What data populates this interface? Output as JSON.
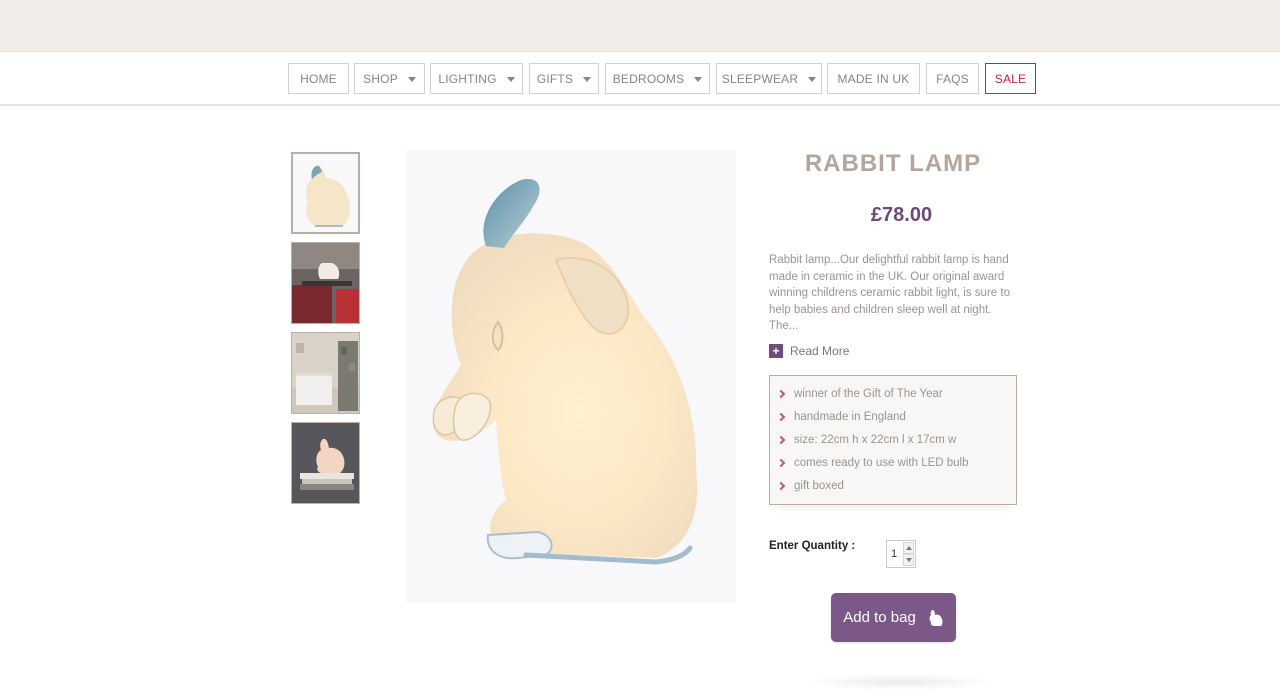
{
  "nav": {
    "items": [
      {
        "label": "HOME",
        "dropdown": false
      },
      {
        "label": "SHOP",
        "dropdown": true
      },
      {
        "label": "LIGHTING",
        "dropdown": true
      },
      {
        "label": "GIFTS",
        "dropdown": true
      },
      {
        "label": "BEDROOMS",
        "dropdown": true
      },
      {
        "label": "SLEEPWEAR",
        "dropdown": true
      },
      {
        "label": "MADE IN UK",
        "dropdown": false
      },
      {
        "label": "FAQS",
        "dropdown": false
      },
      {
        "label": "SALE",
        "dropdown": false
      }
    ],
    "sale_color": "#c8233c"
  },
  "gallery": {
    "thumbnails": [
      "rabbit-lamp-thumb",
      "rabbit-lamp-on-chair-thumb",
      "nursery-room-thumb",
      "rabbit-lamp-on-books-thumb"
    ],
    "active_index": 0,
    "main_image": "rabbit-lamp-image"
  },
  "product": {
    "title": "RABBIT LAMP",
    "price": "£78.00",
    "description": "Rabbit lamp...Our delightful rabbit lamp is hand made in ceramic in the UK. Our original award winning childrens ceramic rabbit light, is sure to help babies and children sleep well at night. The...",
    "read_more": "Read More",
    "read_more_icon": "+",
    "features": [
      "winner of the Gift of The Year",
      "handmade in England",
      "size: 22cm h x 22cm l x 17cm w",
      "comes ready to use with LED bulb",
      "gift boxed"
    ],
    "quantity_label": "Enter Quantity :",
    "quantity": "1",
    "add_to_bag": "Add to bag",
    "add_to_bag_icon": "rabbit-icon"
  },
  "colors": {
    "accent_purple": "#6d4a79",
    "button_purple": "#7c5888",
    "title_taupe": "#b4a69b",
    "chevron_pink": "#c6507a"
  }
}
